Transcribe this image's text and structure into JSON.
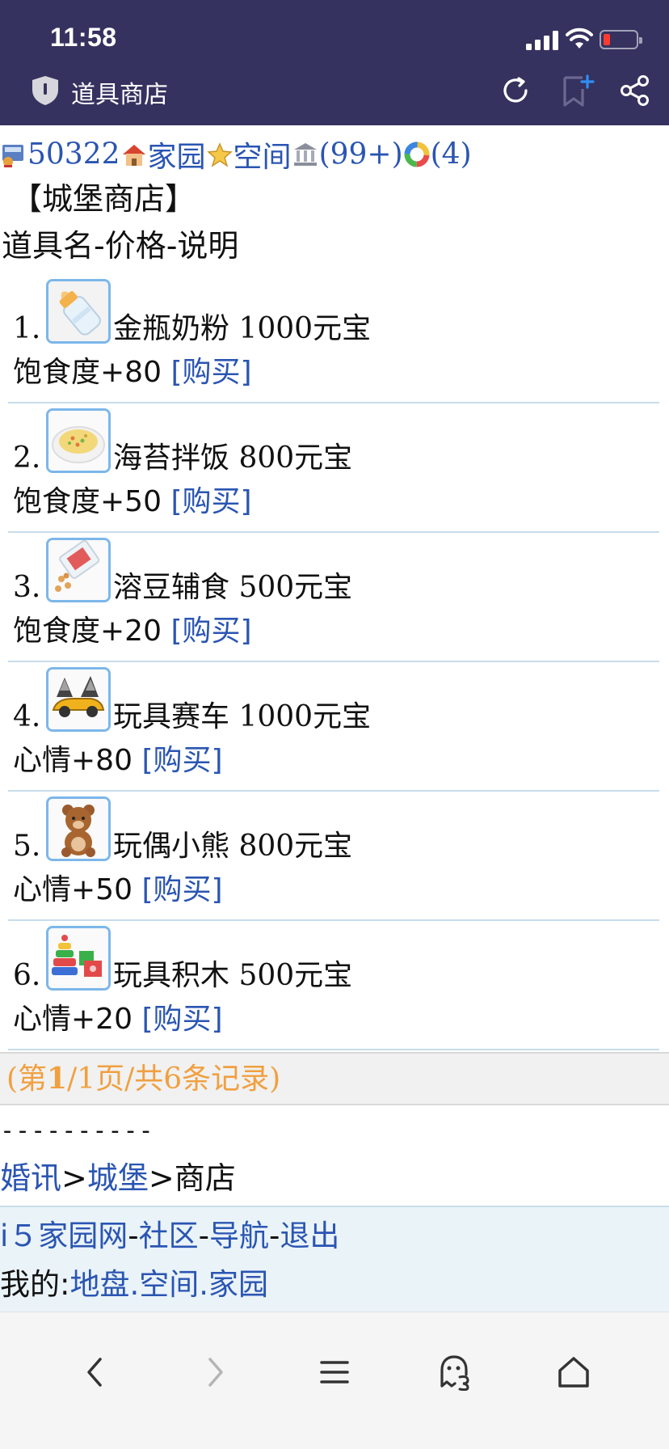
{
  "status_bar": {
    "time": "11:58"
  },
  "browser": {
    "page_title": "道具商店"
  },
  "userbar": {
    "user_id": "50322",
    "home_label": "家园",
    "space_label": "空间",
    "messages_count": "(99+)",
    "notify_count": "(4)"
  },
  "shop": {
    "title": "【城堡商店】",
    "columns": "道具名-价格-说明",
    "items": [
      {
        "index": "1.",
        "name": "金瓶奶粉",
        "price": "1000元宝",
        "effect": "饱食度+80",
        "buy": "[购买]",
        "icon": "milk-bottle-icon"
      },
      {
        "index": "2.",
        "name": "海苔拌饭",
        "price": "800元宝",
        "effect": "饱食度+50",
        "buy": "[购买]",
        "icon": "rice-bowl-icon"
      },
      {
        "index": "3.",
        "name": "溶豆辅食",
        "price": "500元宝",
        "effect": "饱食度+20",
        "buy": "[购买]",
        "icon": "snack-bag-icon"
      },
      {
        "index": "4.",
        "name": "玩具赛车",
        "price": "1000元宝",
        "effect": "心情+80",
        "buy": "[购买]",
        "icon": "race-car-icon"
      },
      {
        "index": "5.",
        "name": "玩偶小熊",
        "price": "800元宝",
        "effect": "心情+50",
        "buy": "[购买]",
        "icon": "teddy-bear-icon"
      },
      {
        "index": "6.",
        "name": "玩具积木",
        "price": "500元宝",
        "effect": "心情+20",
        "buy": "[购买]",
        "icon": "toy-blocks-icon"
      }
    ]
  },
  "pagination": {
    "prefix": "(第",
    "current": "1",
    "suffix": "/1页/共6条记录)"
  },
  "separator": "----------",
  "breadcrumb": {
    "first": "婚讯",
    "sep": ">",
    "second": "城堡",
    "current": "商店"
  },
  "footer": {
    "links": [
      "i５家园网",
      "社区",
      "导航",
      "退出"
    ],
    "dash": "-",
    "mine_label": "我的:",
    "mine_links": [
      "地盘",
      "空间",
      "家园"
    ],
    "dot": "."
  },
  "colors": {
    "topbar": "#35325f",
    "link": "#2a55b2",
    "pagination": "#f0a040",
    "divider": "#c8dcea"
  }
}
